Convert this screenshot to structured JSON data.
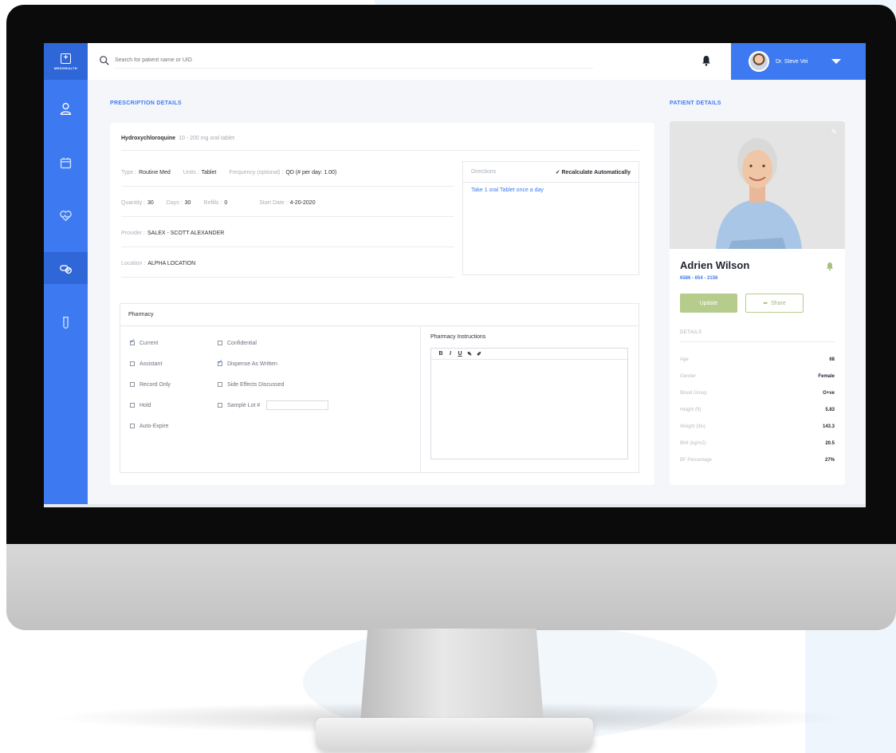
{
  "app": {
    "brand": "MEDIHEALTH",
    "accent_color": "#3d7af1"
  },
  "search": {
    "placeholder": "Search for patient name or UID"
  },
  "user": {
    "name": "Dr. Steve Vei"
  },
  "sidebar": {
    "items": [
      {
        "icon": "user-icon",
        "active": false
      },
      {
        "icon": "calendar-icon",
        "active": false
      },
      {
        "icon": "heart-icon",
        "active": false
      },
      {
        "icon": "prescription-icon",
        "active": true
      },
      {
        "icon": "test-tube-icon",
        "active": false
      }
    ]
  },
  "prescription": {
    "section_title": "PRESCRIPTION DETAILS",
    "drug": "Hydroxychloroquine",
    "dose": "10 - 200 mg oral tablet",
    "type_label": "Type :",
    "type_value": "Routine Med",
    "units_label": "Units :",
    "units_value": "Tablet",
    "frequency_label": "Frequency (optional) :",
    "frequency_value": "QD (# per day: 1.00)",
    "quantity_label": "Quantity :",
    "quantity_value": "30",
    "days_label": "Days :",
    "days_value": "30",
    "refills_label": "Refills :",
    "refills_value": "0",
    "start_label": "Start Date :",
    "start_value": "4-20-2020",
    "provider_label": "Provider :",
    "provider_value": "SALEX - SCOTT ALEXANDER",
    "location_label": "Location :",
    "location_value": "ALPHA LOCATION",
    "directions_label": "Directions",
    "recalculate_label": "Recalculate Automatically",
    "directions_text": "Take 1 oral Tablet once a day"
  },
  "pharmacy": {
    "title": "Pharmacy",
    "col1": [
      {
        "label": "Current",
        "checked": true
      },
      {
        "label": "Assistant",
        "checked": false
      },
      {
        "label": "Record Only",
        "checked": false
      },
      {
        "label": "Hold",
        "checked": false
      },
      {
        "label": "Auto-Expire",
        "checked": false
      }
    ],
    "col2": [
      {
        "label": "Confidential",
        "checked": false
      },
      {
        "label": "Dispense As Written",
        "checked": true
      },
      {
        "label": "Side Effects Discussed",
        "checked": false
      },
      {
        "label": "Sample Lot #",
        "checked": false
      }
    ],
    "instructions_title": "Pharmacy Instructions",
    "editor_tools": [
      "B",
      "I",
      "U",
      "✎",
      "✐"
    ]
  },
  "patient": {
    "section_title": "PATIENT DETAILS",
    "name": "Adrien Wilson",
    "phone": "6586 - 654 - 2156",
    "update_label": "Update",
    "share_label": "Share",
    "details_title": "DETAILS",
    "details": [
      {
        "key": "Age",
        "value": "68"
      },
      {
        "key": "Gender",
        "value": "Female"
      },
      {
        "key": "Blood Group",
        "value": "O+ve"
      },
      {
        "key": "Height (ft)",
        "value": "5.83"
      },
      {
        "key": "Weight (lbs)",
        "value": "143.3"
      },
      {
        "key": "BMI (kg/m2)",
        "value": "20.5"
      },
      {
        "key": "BF Percentage",
        "value": "27%"
      }
    ]
  }
}
